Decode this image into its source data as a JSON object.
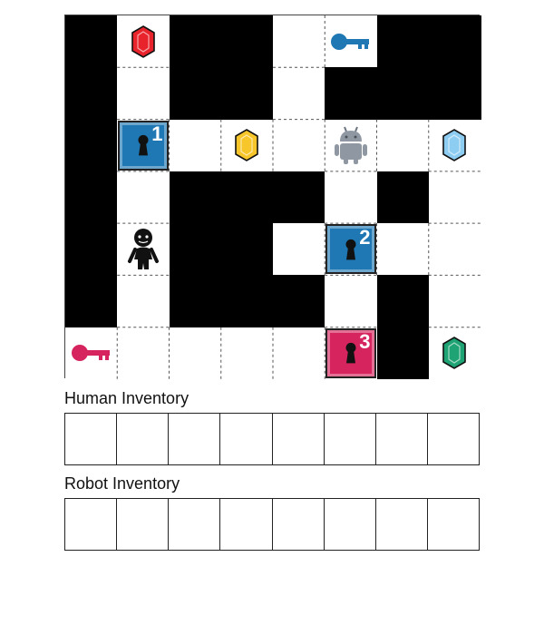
{
  "board": {
    "cols": 8,
    "rows": 7,
    "layout": [
      "#.##.K##",
      "#.##.###",
      "#D....RG",
      "#.###.#.",
      "#H##D...",
      "#.###.#.",
      "K....D#G"
    ],
    "gems": [
      {
        "row": 0,
        "col": 1,
        "color": "red",
        "fill": "#e8232b"
      },
      {
        "row": 2,
        "col": 3,
        "color": "yellow",
        "fill": "#f7c62a"
      },
      {
        "row": 2,
        "col": 7,
        "color": "light-blue",
        "fill": "#8ecdf2"
      },
      {
        "row": 6,
        "col": 7,
        "color": "green",
        "fill": "#1ea374"
      }
    ],
    "keys": [
      {
        "row": 0,
        "col": 5,
        "color": "blue",
        "fill": "#1f78b4"
      },
      {
        "row": 6,
        "col": 0,
        "color": "pink",
        "fill": "#d6245f"
      }
    ],
    "doors": [
      {
        "row": 2,
        "col": 1,
        "number": "1",
        "color": "blue",
        "fill": "#1f78b4"
      },
      {
        "row": 4,
        "col": 5,
        "number": "2",
        "color": "blue",
        "fill": "#1f78b4"
      },
      {
        "row": 6,
        "col": 5,
        "number": "3",
        "color": "pink",
        "fill": "#d6245f"
      }
    ],
    "human": {
      "row": 4,
      "col": 1
    },
    "robot": {
      "row": 2,
      "col": 5
    }
  },
  "human_inventory": {
    "label": "Human Inventory",
    "slots": 8
  },
  "robot_inventory": {
    "label": "Robot Inventory",
    "slots": 8
  }
}
